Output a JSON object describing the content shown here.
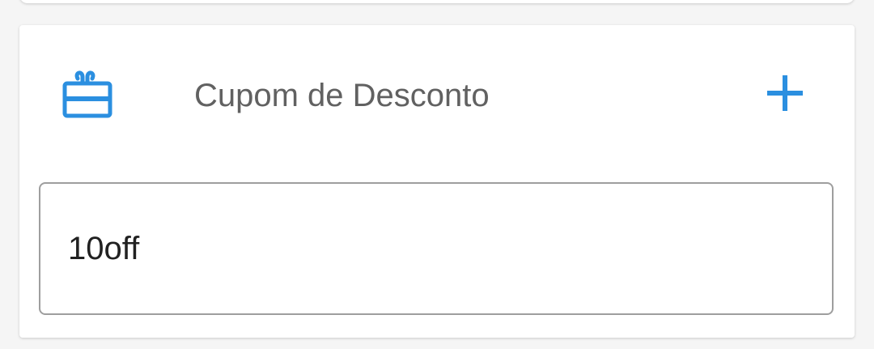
{
  "coupon_section": {
    "title": "Cupom de Desconto",
    "icon": "gift-card-icon",
    "add_icon": "plus-icon",
    "input_value": "10off"
  },
  "colors": {
    "accent": "#2b8fe0",
    "title_text": "#616161",
    "input_text": "#212121",
    "input_border": "#9e9e9e"
  }
}
